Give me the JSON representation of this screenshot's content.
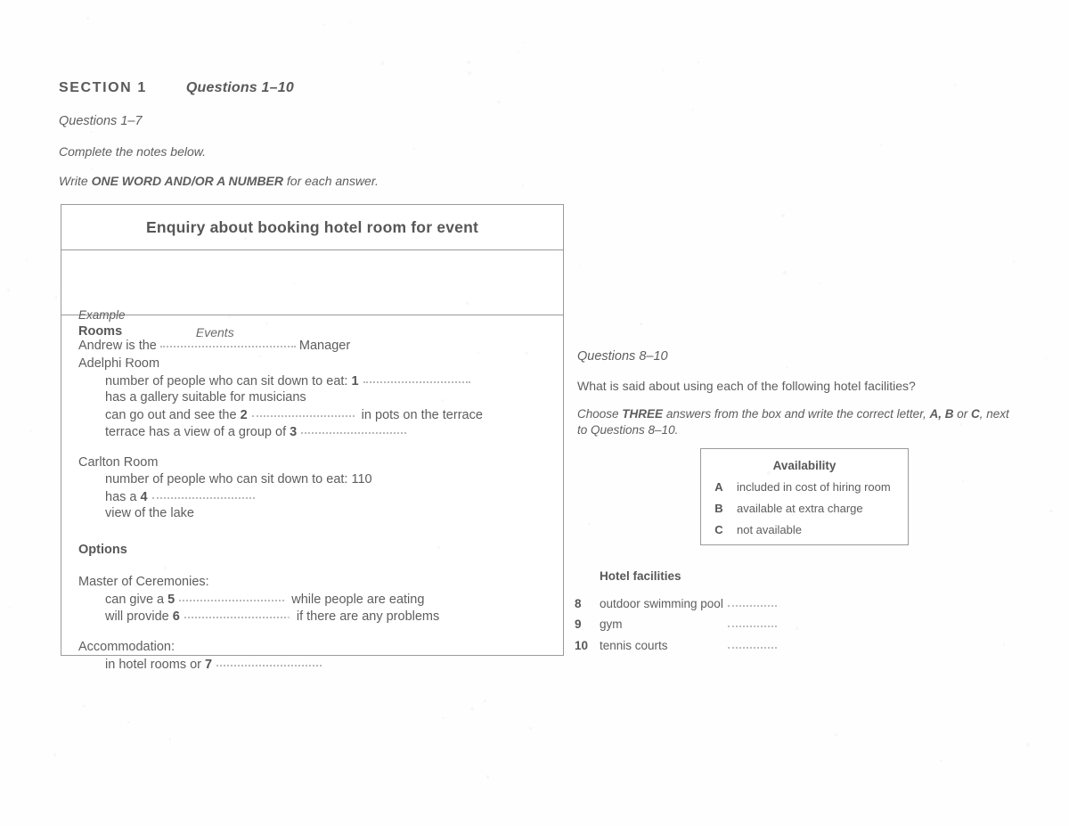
{
  "header": {
    "section_label": "SECTION 1",
    "section_questions": "Questions 1–10",
    "questions_range": "Questions 1–7",
    "instruction_complete": "Complete the notes below.",
    "instruction_write_prefix": "Write ",
    "instruction_write_bold": "ONE WORD AND/OR A NUMBER",
    "instruction_write_suffix": " for each answer."
  },
  "notes": {
    "title": "Enquiry about booking hotel room for event",
    "example": {
      "label": "Example",
      "sentence_before": "Andrew is the ",
      "answer": "Events",
      "sentence_after": " Manager"
    },
    "groups": [
      {
        "heading": "Rooms",
        "subgroups": [
          {
            "name": "Adelphi Room",
            "lines": [
              {
                "text_before": "number of people who can sit down to eat: ",
                "q": "1",
                "text_after": "",
                "gap": 120
              },
              {
                "text_before": "has a gallery suitable for musicians",
                "q": "",
                "text_after": "",
                "gap": 0
              },
              {
                "text_before": "can go out and see the ",
                "q": "2",
                "text_after": " in pots on the terrace",
                "gap": 115
              },
              {
                "text_before": "terrace has a view of a group of ",
                "q": "3",
                "text_after": "",
                "gap": 118
              }
            ]
          },
          {
            "name": "Carlton Room",
            "lines": [
              {
                "text_before": "number of people who can sit down to eat: 110",
                "q": "",
                "text_after": "",
                "gap": 0
              },
              {
                "text_before": "has a ",
                "q": "4",
                "text_after": "",
                "gap": 115
              },
              {
                "text_before": "view of the lake",
                "q": "",
                "text_after": "",
                "gap": 0
              }
            ]
          }
        ]
      },
      {
        "heading": "Options",
        "subgroups": [
          {
            "name": "Master of Ceremonies:",
            "lines": [
              {
                "text_before": "can give a ",
                "q": "5",
                "text_after": " while people are eating",
                "gap": 118
              },
              {
                "text_before": "will provide ",
                "q": "6",
                "text_after": " if there are any problems",
                "gap": 118
              }
            ]
          },
          {
            "name": "Accommodation:",
            "lines": [
              {
                "text_before": "in hotel rooms or ",
                "q": "7",
                "text_after": "",
                "gap": 118
              }
            ]
          }
        ]
      }
    ]
  },
  "right_column": {
    "questions_range": "Questions 8–10",
    "prompt": "What is said about using each of the following hotel facilities?",
    "instruction_part1": "Choose ",
    "instruction_bold1": "THREE",
    "instruction_part2": " answers from the box and write the correct letter, ",
    "instruction_bold2": "A, B",
    "instruction_part3": " or ",
    "instruction_bold3": "C",
    "instruction_part4": ", next to Questions 8–10.",
    "availability_box": {
      "title": "Availability",
      "options": [
        {
          "letter": "A",
          "text": "included in cost of hiring room"
        },
        {
          "letter": "B",
          "text": "available at extra charge"
        },
        {
          "letter": "C",
          "text": "not available"
        }
      ]
    },
    "facilities_heading": "Hotel facilities",
    "facilities": [
      {
        "number": "8",
        "name": "outdoor swimming pool",
        "answer": ""
      },
      {
        "number": "9",
        "name": "gym",
        "answer": ""
      },
      {
        "number": "10",
        "name": "tennis courts",
        "answer": ""
      }
    ]
  },
  "colors": {
    "text": "#5e5e5e",
    "heading": "#575757",
    "border": "#9a9a9a",
    "dots": "#b9b9b9",
    "background": "#ffffff"
  }
}
